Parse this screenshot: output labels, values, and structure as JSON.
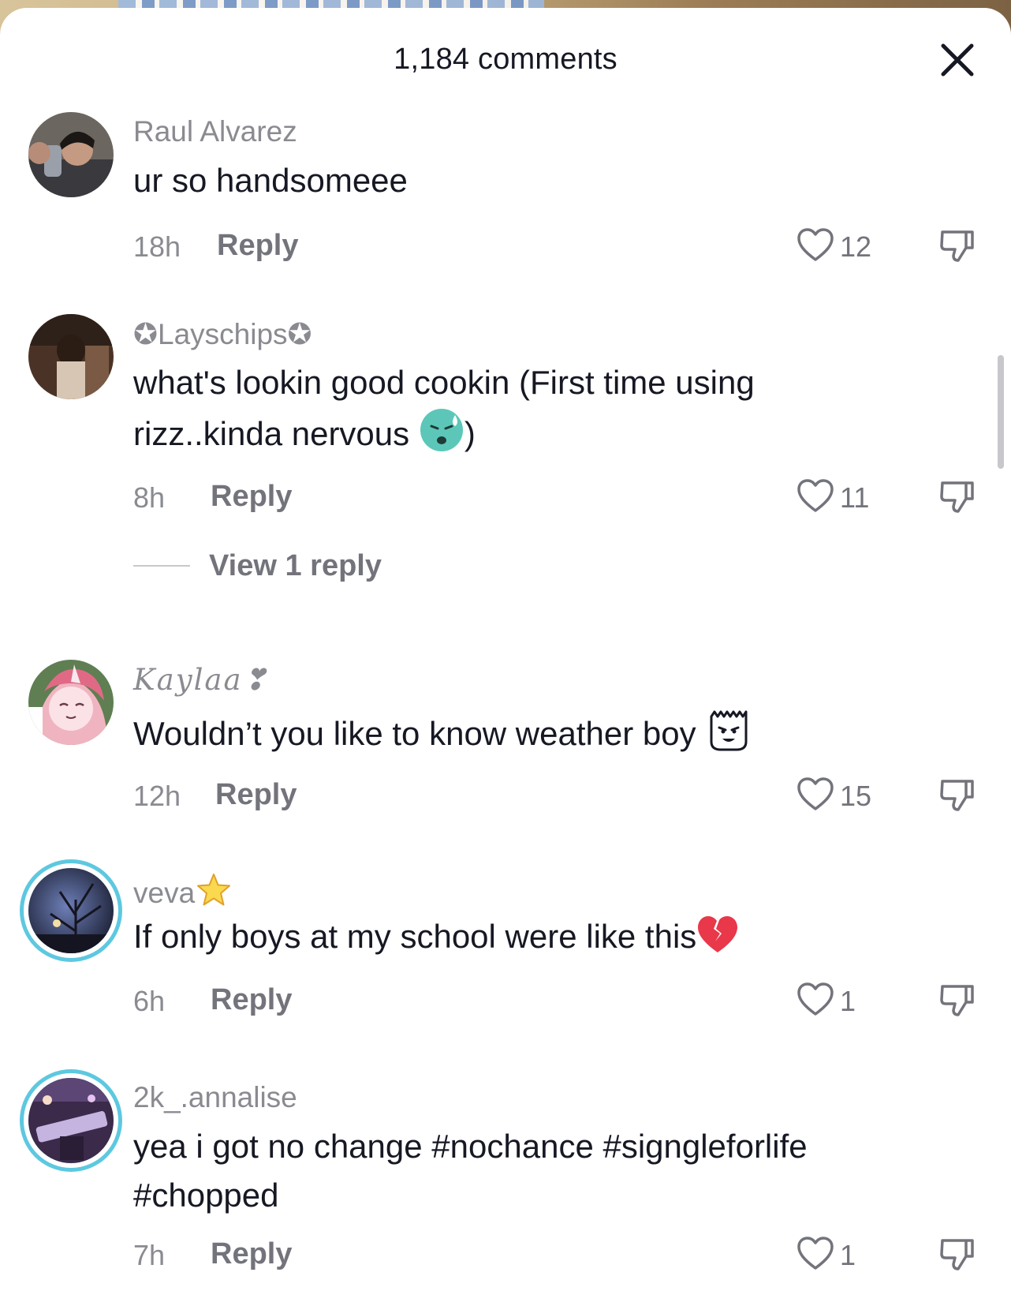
{
  "header": {
    "title": "1,184 comments"
  },
  "comments": [
    {
      "username": "Raul Alvarez",
      "text": "ur so handsomeee",
      "time": "18h",
      "reply_label": "Reply",
      "likes": "12"
    },
    {
      "username": "✪Layschips✪",
      "text_line1": "what's lookin good cookin (First time using",
      "text_line2": "rizz..kinda nervous ",
      "text_after_emoji": ")",
      "time": "8h",
      "reply_label": "Reply",
      "likes": "11",
      "view_replies": "View 1 reply"
    },
    {
      "username": "Kaylaa❣",
      "text": "Wouldn’t you like to know weather boy ",
      "time": "12h",
      "reply_label": "Reply",
      "likes": "15"
    },
    {
      "username": "veva",
      "text": "If only boys at my school were like this",
      "time": "6h",
      "reply_label": "Reply",
      "likes": "1"
    },
    {
      "username": "2k_.annalise",
      "text_line1": "yea i got no change #nochance #signgleforlife",
      "text_line2": "#chopped",
      "time": "7h",
      "reply_label": "Reply",
      "likes": "1"
    }
  ],
  "colors": {
    "text": "#161823",
    "secondary": "#8a8b91",
    "story_ring": "#5dc8e0"
  },
  "icons": [
    "close-icon",
    "heart-icon",
    "dislike-icon",
    "sweat-emoji",
    "bart-emoji",
    "star-emoji",
    "broken-heart-emoji"
  ]
}
